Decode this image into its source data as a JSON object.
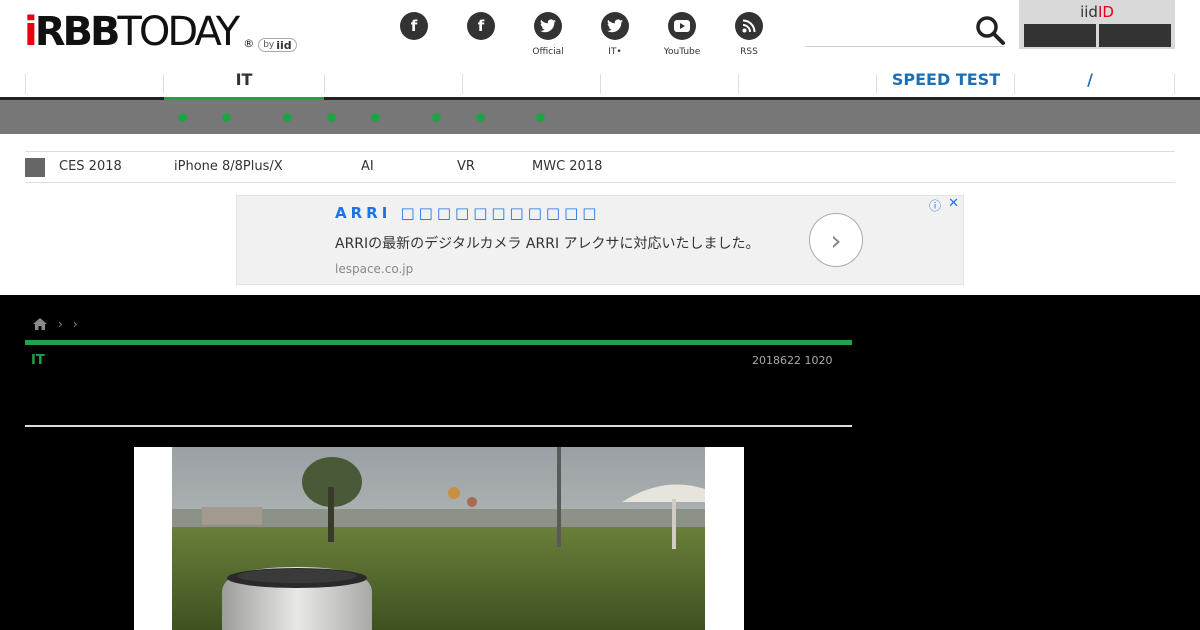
{
  "header": {
    "logo_main": "RBB",
    "logo_i": "i",
    "logo_today": "TODAY",
    "logo_reg": "®",
    "logo_by": "by",
    "logo_by_brand": "iid",
    "social": [
      {
        "icon": "facebook-icon",
        "glyph": "f",
        "label": ""
      },
      {
        "icon": "facebook-icon",
        "glyph": "f",
        "label": ""
      },
      {
        "icon": "twitter-icon",
        "glyph": "🐦",
        "label": "Official"
      },
      {
        "icon": "twitter-icon",
        "glyph": "🐦",
        "label": "IT•"
      },
      {
        "icon": "youtube-icon",
        "glyph": "▶",
        "label": "YouTube"
      },
      {
        "icon": "rss-icon",
        "glyph": "◉",
        "label": "RSS"
      }
    ],
    "iid_title_prefix": "iid",
    "iid_title_suffix": "ID"
  },
  "nav": {
    "it_label": "IT",
    "speed_test_label": "SPEED TEST",
    "slash_label": "/"
  },
  "tags": {
    "items": [
      "CES 2018",
      "iPhone 8/8Plus/X",
      "AI",
      "VR",
      "MWC 2018"
    ]
  },
  "ad": {
    "title": "ARRI □□□□□□□□□□□",
    "body": "ARRIの最新のデジタルカメラ ARRI アレクサに対応いたしました。",
    "url": "lespace.co.jp",
    "info_glyph": "ⓘ",
    "close_glyph": "✕",
    "arrow_glyph": "›"
  },
  "article": {
    "breadcrumb_sep": "›",
    "category": "IT",
    "date": "2018622 1020"
  },
  "colors": {
    "accent_green": "#1fa346",
    "link_blue": "#1a6fb5",
    "logo_red": "#e60012"
  }
}
